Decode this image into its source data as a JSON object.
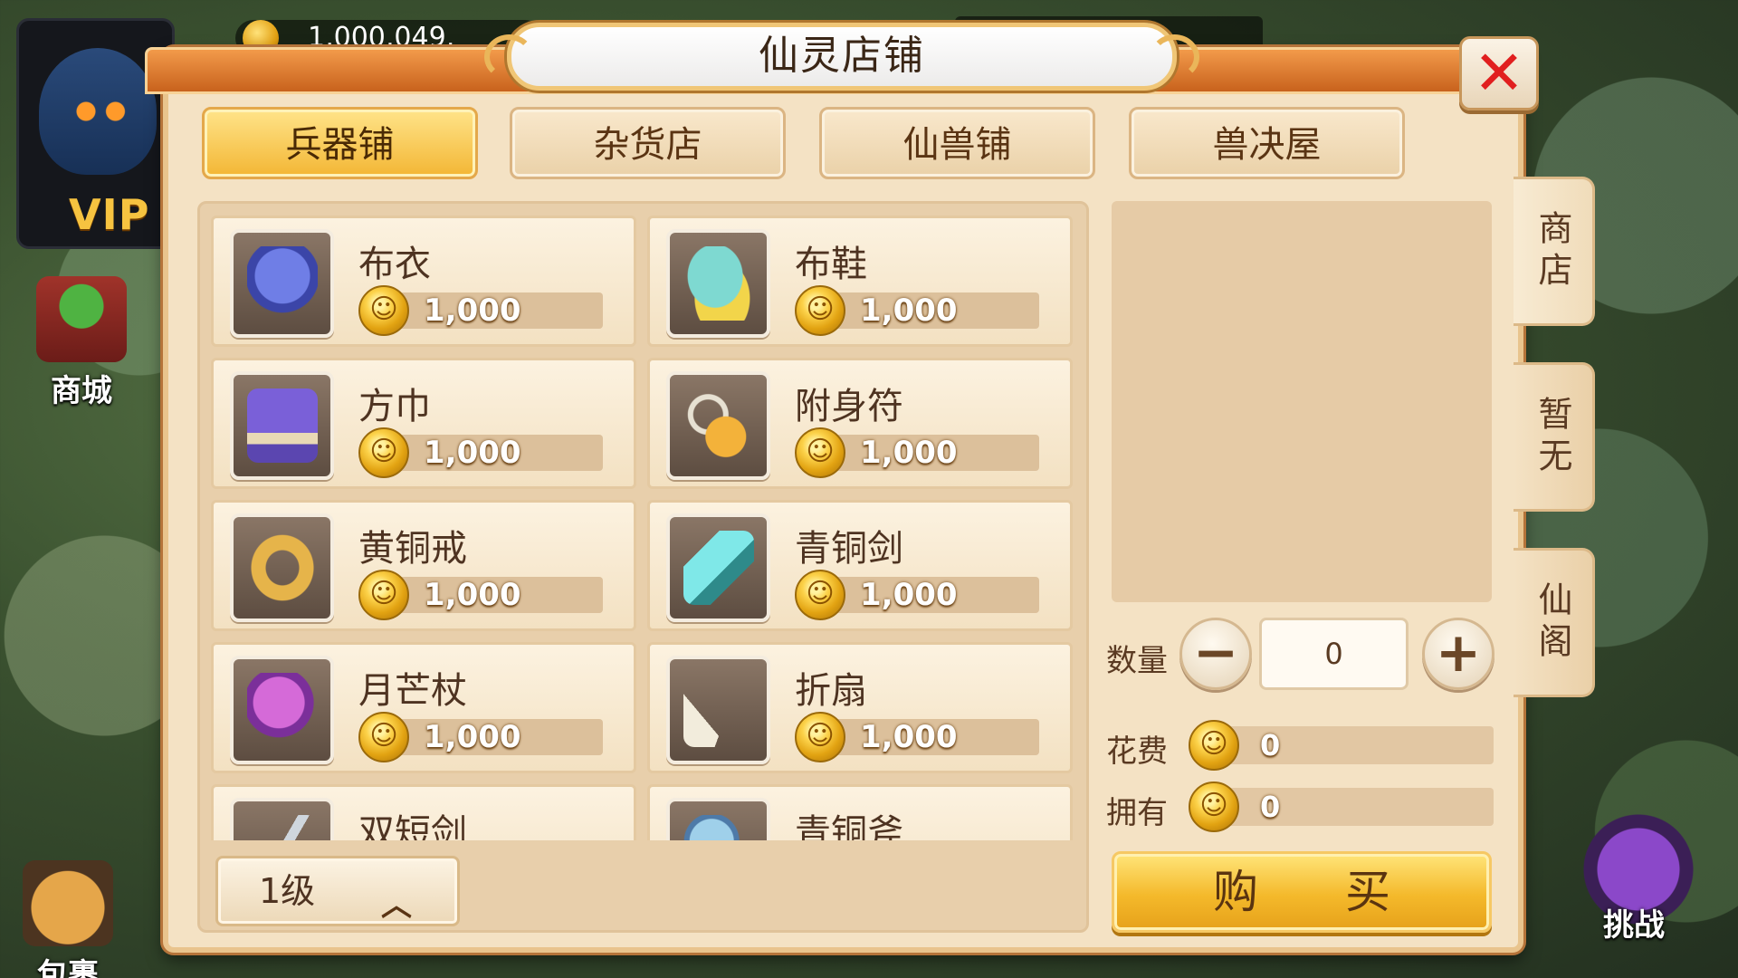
{
  "hud": {
    "gold_amount": "1,000,049,",
    "vip_label": "VIP",
    "mall_label": "商城",
    "bag_label": "包裹",
    "challenge_label": "挑战"
  },
  "shop": {
    "title": "仙灵店铺",
    "tabs": [
      {
        "label": "兵器铺",
        "active": true
      },
      {
        "label": "杂货店",
        "active": false
      },
      {
        "label": "仙兽铺",
        "active": false
      },
      {
        "label": "兽决屋",
        "active": false
      }
    ],
    "items": [
      {
        "name": "布衣",
        "price": "1,000",
        "icon": "robe-icon"
      },
      {
        "name": "布鞋",
        "price": "1,000",
        "icon": "shoes-icon"
      },
      {
        "name": "方巾",
        "price": "1,000",
        "icon": "hat-icon"
      },
      {
        "name": "附身符",
        "price": "1,000",
        "icon": "talisman-icon"
      },
      {
        "name": "黄铜戒",
        "price": "1,000",
        "icon": "ring-icon"
      },
      {
        "name": "青铜剑",
        "price": "1,000",
        "icon": "sword-icon"
      },
      {
        "name": "月芒杖",
        "price": "1,000",
        "icon": "staff-icon"
      },
      {
        "name": "折扇",
        "price": "1,000",
        "icon": "fan-icon"
      },
      {
        "name": "双短剑",
        "price": "",
        "icon": "dagger-icon"
      },
      {
        "name": "青铜斧",
        "price": "",
        "icon": "axe-icon"
      }
    ],
    "level_selector": "1级",
    "quantity_label": "数量",
    "quantity_value": "0",
    "cost_label": "花费",
    "cost_value": "0",
    "owned_label": "拥有",
    "owned_value": "0",
    "buy_label": "购 买",
    "side_tabs": [
      {
        "label": "商店",
        "active": true
      },
      {
        "label": "暂无",
        "active": false
      },
      {
        "label": "仙阁",
        "active": false
      }
    ]
  },
  "colors": {
    "panel_bg": "#f4e2c4",
    "active_tab": "#f3b634",
    "close_x": "#e11f1f",
    "coin": "#e2a312"
  }
}
